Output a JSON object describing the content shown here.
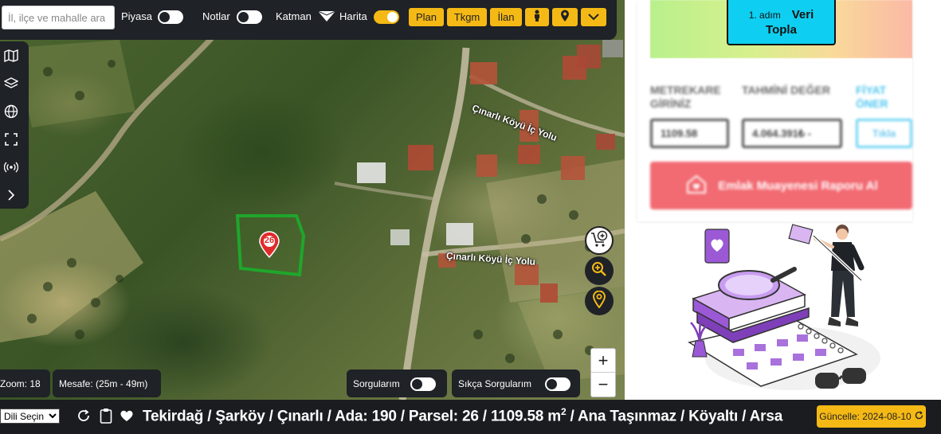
{
  "toolbar": {
    "search_placeholder": "İl, ilçe ve mahalle ara",
    "piyasa_label": "Piyasa",
    "notlar_label": "Notlar",
    "katman_label": "Katman",
    "harita_label": "Harita",
    "buttons": [
      "Plan",
      "Tkgm",
      "İlan"
    ]
  },
  "map": {
    "parcel_number": "26",
    "road_labels": [
      "Çınarlı Köyü İç Yolu",
      "Çınarlı Köyü İç Yolu"
    ],
    "zoom_text": "Zoom: 18",
    "distance_text": "Mesafe: (25m - 49m)",
    "sorgularim_label": "Sorgularım",
    "sikca_label": "Sıkça Sorgularım",
    "zoom_in": "+",
    "zoom_out": "−"
  },
  "bottom": {
    "language_select": "Dili Seçin",
    "breadcrumb_main": "Tekirdağ / Şarköy / Çınarlı / Ada: 190 / Parsel: 26 / 1109.58 m",
    "breadcrumb_sup": "2",
    "breadcrumb_tail": " / Ana Taşınmaz / Köyaltı / Arsa",
    "update_text": "Güncelle: 2024-08-10"
  },
  "panel": {
    "step_label": "1. adım",
    "veri_word": "Veri",
    "topla_word": "Topla",
    "col1_line1": "METREKARE",
    "col1_line2": "GİRİNİZ",
    "col2": "TAHMİNİ DEĞER",
    "col3_line1": "FİYAT",
    "col3_line2": "ÖNER",
    "area_value": "1109.58",
    "estimate_value": "4.064.391₺ -",
    "tikla": "Tıkla",
    "report_button": "Emlak Muayenesi Raporu Al"
  },
  "colors": {
    "toolbar_bg": "#1f2227",
    "accent_yellow": "#f5b915",
    "parcel_outline": "#1fa62b",
    "veri_button": "#0ecff1",
    "report_button": "#f26a72",
    "illustration_purple": "#9b59d6"
  },
  "icons": [
    "map-icon",
    "layers-icon",
    "globe-icon",
    "fullscreen-icon",
    "broadcast-icon",
    "chevron-right-icon",
    "triangle-icon",
    "person-icon",
    "location-pin-icon",
    "chevron-down-icon",
    "cart-add-icon",
    "zoom-search-icon",
    "map-marker-icon",
    "refresh-icon",
    "clipboard-icon",
    "heart-icon"
  ]
}
